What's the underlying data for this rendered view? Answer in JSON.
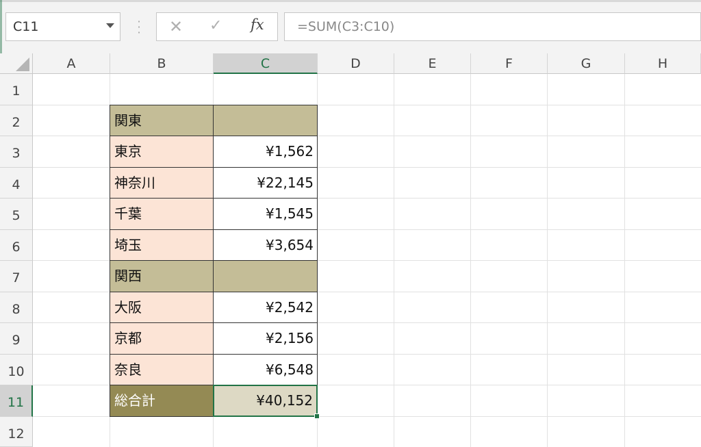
{
  "toolbar": {
    "name_box": "C11",
    "cancel_icon": "✕",
    "enter_icon": "✓",
    "fx_label": "fx",
    "formula": "=SUM(C3:C10)"
  },
  "columns": [
    "A",
    "B",
    "C",
    "D",
    "E",
    "F",
    "G",
    "H"
  ],
  "rows": [
    "1",
    "2",
    "3",
    "4",
    "5",
    "6",
    "7",
    "8",
    "9",
    "10",
    "11",
    "12"
  ],
  "selected_cell": "C11",
  "colors": {
    "accent": "#217346",
    "region_fill": "#c4bd97",
    "label_fill": "#fce4d6",
    "total_fill": "#948a54",
    "total_value_fill": "#ddd9c4"
  },
  "table": {
    "r2": {
      "b": "関東",
      "c": ""
    },
    "r3": {
      "b": "東京",
      "c": "¥1,562"
    },
    "r4": {
      "b": "神奈川",
      "c": "¥22,145"
    },
    "r5": {
      "b": "千葉",
      "c": "¥1,545"
    },
    "r6": {
      "b": "埼玉",
      "c": "¥3,654"
    },
    "r7": {
      "b": "関西",
      "c": ""
    },
    "r8": {
      "b": "大阪",
      "c": "¥2,542"
    },
    "r9": {
      "b": "京都",
      "c": "¥2,156"
    },
    "r10": {
      "b": "奈良",
      "c": "¥6,548"
    },
    "r11": {
      "b": "総合計",
      "c": "¥40,152"
    }
  }
}
